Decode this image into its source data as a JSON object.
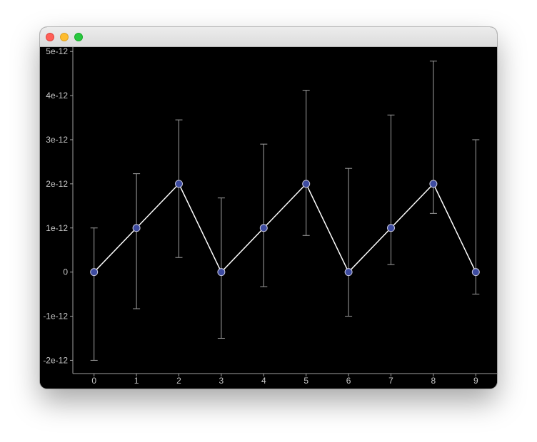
{
  "window": {
    "title": ""
  },
  "chart_data": {
    "type": "line",
    "title": "",
    "xlabel": "",
    "ylabel": "",
    "x": [
      0,
      1,
      2,
      3,
      4,
      5,
      6,
      7,
      8,
      9
    ],
    "y": [
      0,
      1e-12,
      2e-12,
      0,
      1e-12,
      2e-12,
      0,
      1e-12,
      2e-12,
      0
    ],
    "yerr_low": [
      2e-12,
      1.83e-12,
      1.67e-12,
      1.5e-12,
      1.33e-12,
      1.17e-12,
      1e-12,
      8.3e-13,
      6.7e-13,
      5e-13
    ],
    "yerr_high": [
      1e-12,
      1.23e-12,
      1.45e-12,
      1.68e-12,
      1.9e-12,
      2.12e-12,
      2.35e-12,
      2.56e-12,
      2.78e-12,
      3e-12
    ],
    "xlim": [
      -0.5,
      9.5
    ],
    "ylim": [
      -2.3e-12,
      5.1e-12
    ],
    "xticks": [
      "0",
      "1",
      "2",
      "3",
      "4",
      "5",
      "6",
      "7",
      "8",
      "9"
    ],
    "yticks": [
      {
        "value": -2e-12,
        "label": "-2e-12"
      },
      {
        "value": -1e-12,
        "label": "-1e-12"
      },
      {
        "value": 0,
        "label": "0"
      },
      {
        "value": 1e-12,
        "label": "1e-12"
      },
      {
        "value": 2e-12,
        "label": "2e-12"
      },
      {
        "value": 3e-12,
        "label": "3e-12"
      },
      {
        "value": 4e-12,
        "label": "4e-12"
      },
      {
        "value": 5e-12,
        "label": "5e-12"
      }
    ],
    "grid": false,
    "colors": {
      "background": "#000000",
      "line": "#ffffff",
      "marker_fill": "#3d4ba0",
      "marker_edge": "#c8c8e0",
      "errorbar": "#a0a0a0",
      "axis": "#a0a0a0",
      "tick_label": "#c8c8c8"
    }
  }
}
